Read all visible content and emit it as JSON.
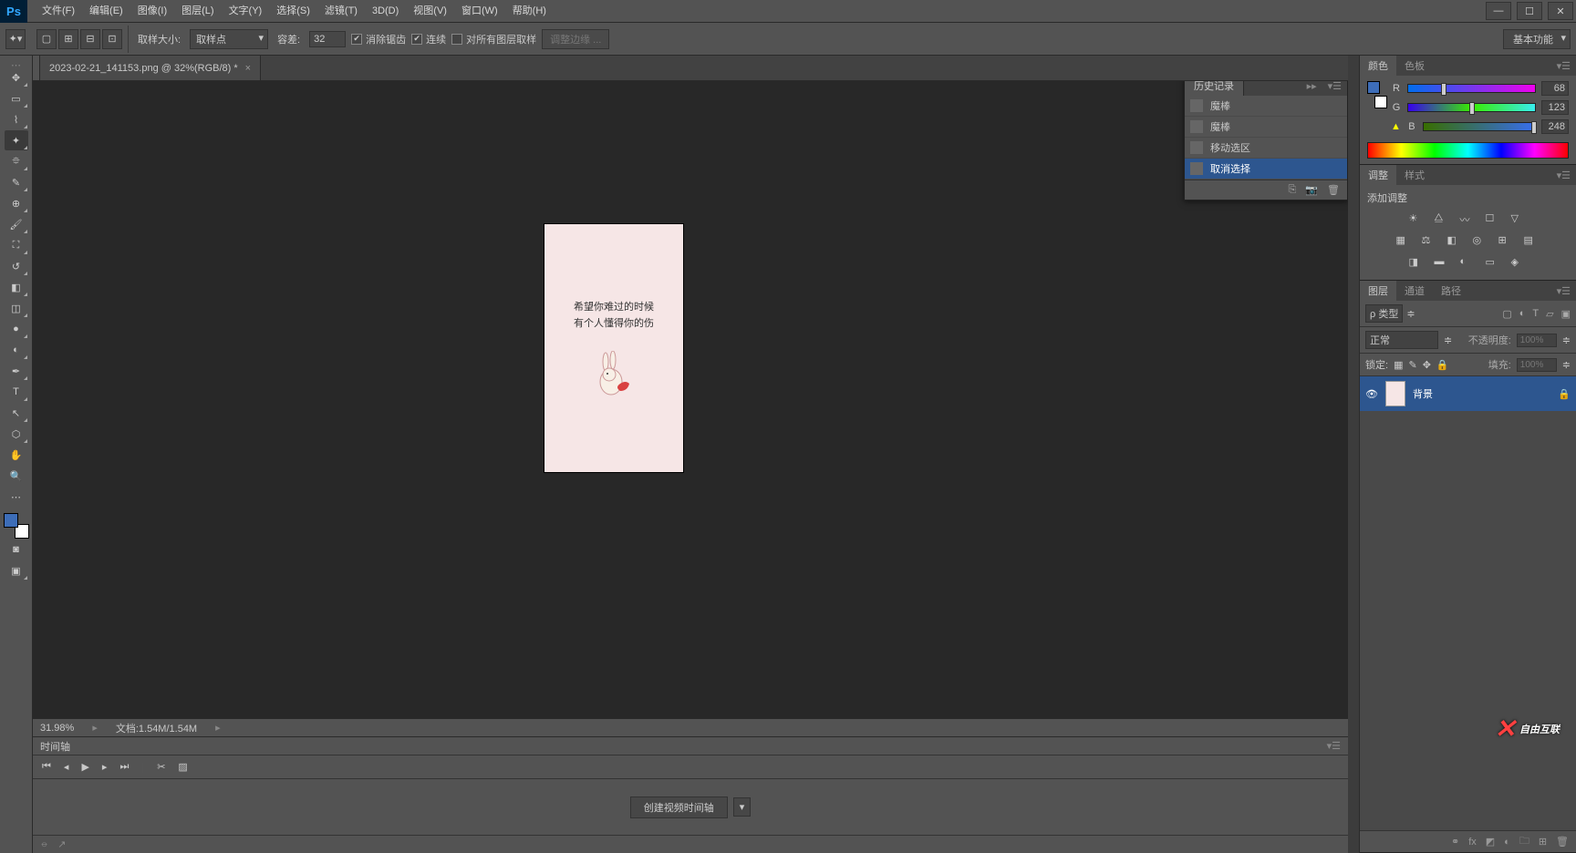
{
  "menu": {
    "file": "文件(F)",
    "edit": "编辑(E)",
    "image": "图像(I)",
    "layer": "图层(L)",
    "type": "文字(Y)",
    "select": "选择(S)",
    "filter": "滤镜(T)",
    "view3d": "3D(D)",
    "view": "视图(V)",
    "window": "窗口(W)",
    "help": "帮助(H)"
  },
  "options": {
    "sample_size_label": "取样大小:",
    "sample_size_val": "取样点",
    "tolerance_label": "容差:",
    "tolerance_val": "32",
    "antialias": "消除锯齿",
    "contiguous": "连续",
    "all_layers": "对所有图层取样",
    "refine_edge": "调整边缘 ...",
    "workspace": "基本功能"
  },
  "tab": {
    "title": "2023-02-21_141153.png @ 32%(RGB/8) *"
  },
  "canvas": {
    "line1": "希望你难过的时候",
    "line2": "有个人懂得你的伤"
  },
  "history": {
    "title": "历史记录",
    "items": [
      "魔棒",
      "魔棒",
      "移动选区",
      "取消选择"
    ]
  },
  "status": {
    "zoom": "31.98%",
    "doc": "文档:1.54M/1.54M"
  },
  "timeline": {
    "title": "时间轴",
    "create": "创建视频时间轴"
  },
  "color": {
    "tab_color": "颜色",
    "tab_swatch": "色板",
    "r": "R",
    "g": "G",
    "b": "B",
    "rv": "68",
    "gv": "123",
    "bv": "248"
  },
  "adjust": {
    "tab_adjust": "调整",
    "tab_style": "样式",
    "add": "添加调整"
  },
  "layers": {
    "tab_layer": "图层",
    "tab_channel": "通道",
    "tab_path": "路径",
    "kind": "ρ 类型",
    "blend": "正常",
    "opacity_label": "不透明度:",
    "opacity_val": "100%",
    "lock_label": "锁定:",
    "fill_label": "填充:",
    "fill_val": "100%",
    "layer_name": "背景"
  },
  "watermark": "自由互联"
}
